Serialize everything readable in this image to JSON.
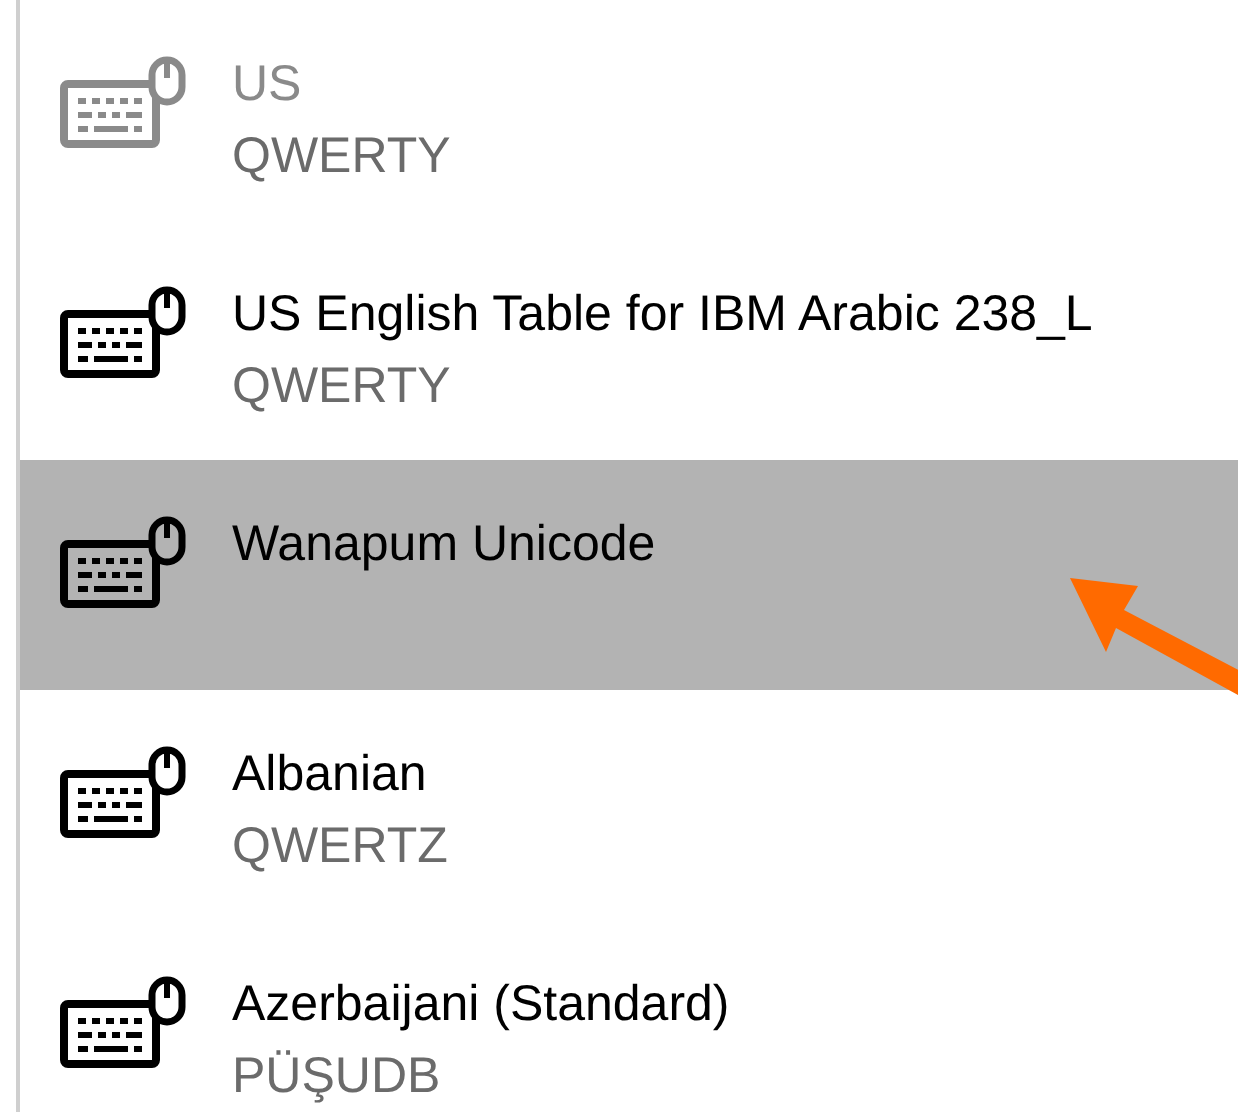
{
  "layouts": [
    {
      "name": "US",
      "layout": "QWERTY",
      "disabled": true,
      "selected": false
    },
    {
      "name": "US English Table for IBM Arabic 238_L",
      "layout": "QWERTY",
      "disabled": false,
      "selected": false
    },
    {
      "name": "Wanapum Unicode",
      "disabled": false,
      "selected": true
    },
    {
      "name": "Albanian",
      "layout": "QWERTZ",
      "disabled": false,
      "selected": false
    },
    {
      "name": "Azerbaijani (Standard)",
      "layout": "PÜŞUDB",
      "disabled": false,
      "selected": false
    }
  ]
}
